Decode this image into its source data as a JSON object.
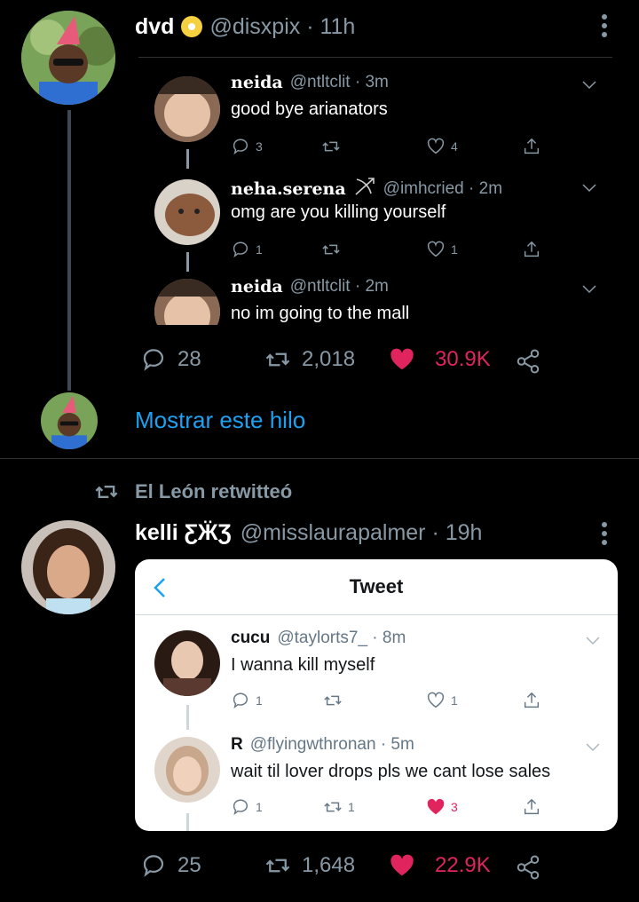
{
  "tweet1": {
    "display_name": "dvd",
    "handle_time": "@disxpix · 11h",
    "embedded": [
      {
        "name": "neida",
        "meta": "@ntltclit · 3m",
        "text": "good bye arianators",
        "replies": "3",
        "retweets": "",
        "likes": "4"
      },
      {
        "name": "neha.serena",
        "meta": "@imhcried · 2m",
        "text": "omg are you killing yourself",
        "replies": "1",
        "retweets": "",
        "likes": "1"
      },
      {
        "name": "neida",
        "meta": "@ntltclit · 2m",
        "text": "no im going to the mall"
      }
    ],
    "replies": "28",
    "retweets": "2,018",
    "likes": "30.9K",
    "show_thread": "Mostrar este hilo"
  },
  "retweet_label": "El León retwitteó",
  "tweet2": {
    "display_name": "kelli ƸӜƷ",
    "handle_time": "@misslaurapalmer · 19h",
    "card_title": "Tweet",
    "embedded": [
      {
        "name": "cucu",
        "meta": "@taylorts7_ · 8m",
        "text": "I wanna kill myself",
        "replies": "1",
        "retweets": "",
        "likes": "1"
      },
      {
        "name": "R",
        "meta": "@flyingwthronan · 5m",
        "text": "wait til lover drops pls we cant lose sales",
        "replies": "1",
        "retweets": "1",
        "likes": "3"
      }
    ],
    "replies": "25",
    "retweets": "1,648",
    "likes": "22.9K"
  },
  "colors": {
    "like_red": "#e0245e",
    "link_blue": "#1da1f2",
    "muted": "#8899a6"
  }
}
